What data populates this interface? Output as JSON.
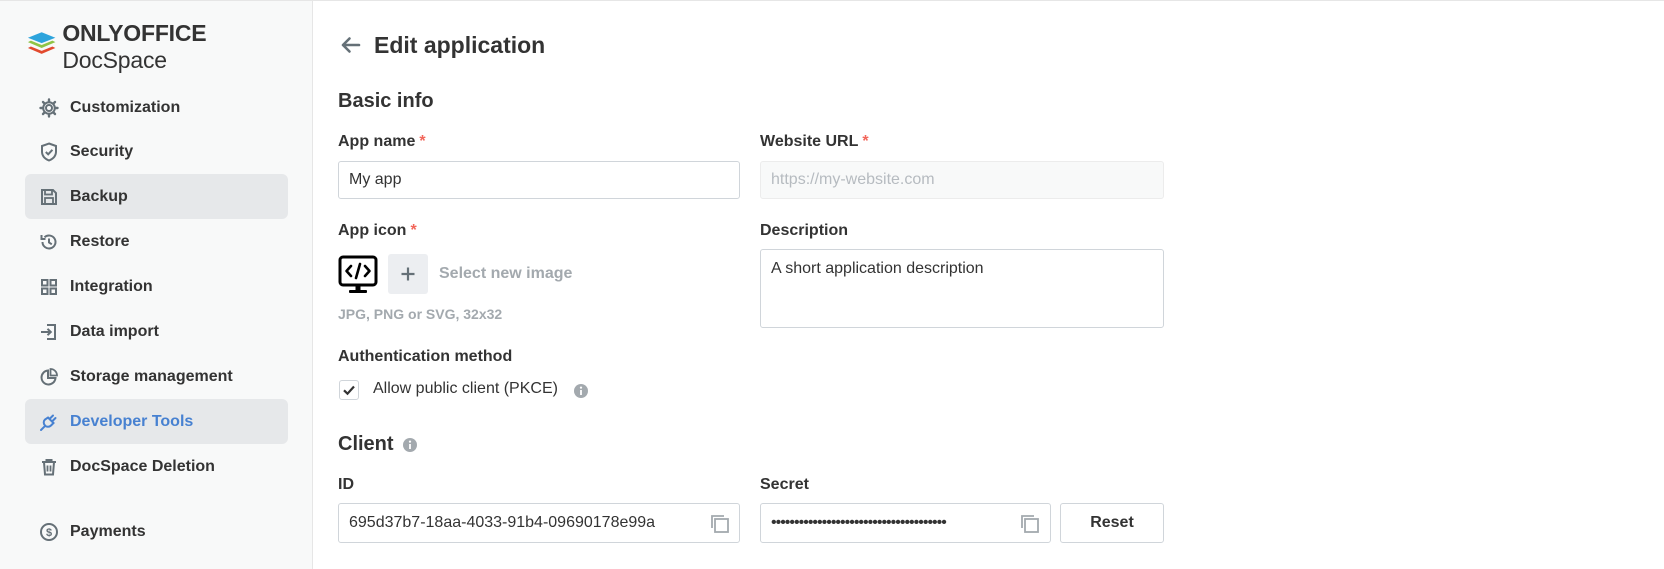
{
  "brand": {
    "name_bold": "ONLYOFFICE",
    "name_regular": "DocSpace"
  },
  "sidebar": {
    "items": [
      {
        "label": "Customization",
        "icon": "gear-icon"
      },
      {
        "label": "Security",
        "icon": "shield-icon"
      },
      {
        "label": "Backup",
        "icon": "save-icon",
        "active": true
      },
      {
        "label": "Restore",
        "icon": "history-icon"
      },
      {
        "label": "Integration",
        "icon": "grid-icon"
      },
      {
        "label": "Data import",
        "icon": "import-icon"
      },
      {
        "label": "Storage management",
        "icon": "pie-chart-icon"
      },
      {
        "label": "Developer Tools",
        "icon": "plug-icon",
        "active": true,
        "accent": true
      },
      {
        "label": "DocSpace Deletion",
        "icon": "trash-icon"
      },
      {
        "label": "Payments",
        "icon": "dollar-icon"
      }
    ]
  },
  "header": {
    "title": "Edit application"
  },
  "basic_info": {
    "title": "Basic info",
    "app_name": {
      "label": "App name",
      "required_mark": "*",
      "value": "My app"
    },
    "website_url": {
      "label": "Website URL",
      "required_mark": "*",
      "placeholder": "https://my-website.com"
    },
    "app_icon": {
      "label": "App icon",
      "required_mark": "*",
      "select_label": "Select new image",
      "hint": "JPG, PNG or SVG, 32x32"
    },
    "description": {
      "label": "Description",
      "value": "A short application description"
    },
    "auth": {
      "label": "Authentication method",
      "checkbox_label": "Allow public client (PKCE)",
      "checked": true
    }
  },
  "client": {
    "title": "Client",
    "id": {
      "label": "ID",
      "value": "695d37b7-18aa-4033-91b4-09690178e99a"
    },
    "secret": {
      "label": "Secret",
      "value": "••••••••••••••••••••••••••••••••••••••"
    },
    "reset_label": "Reset"
  },
  "colors": {
    "accent": "#4781d1",
    "required": "#f2665a",
    "muted": "#a3a9ae"
  }
}
